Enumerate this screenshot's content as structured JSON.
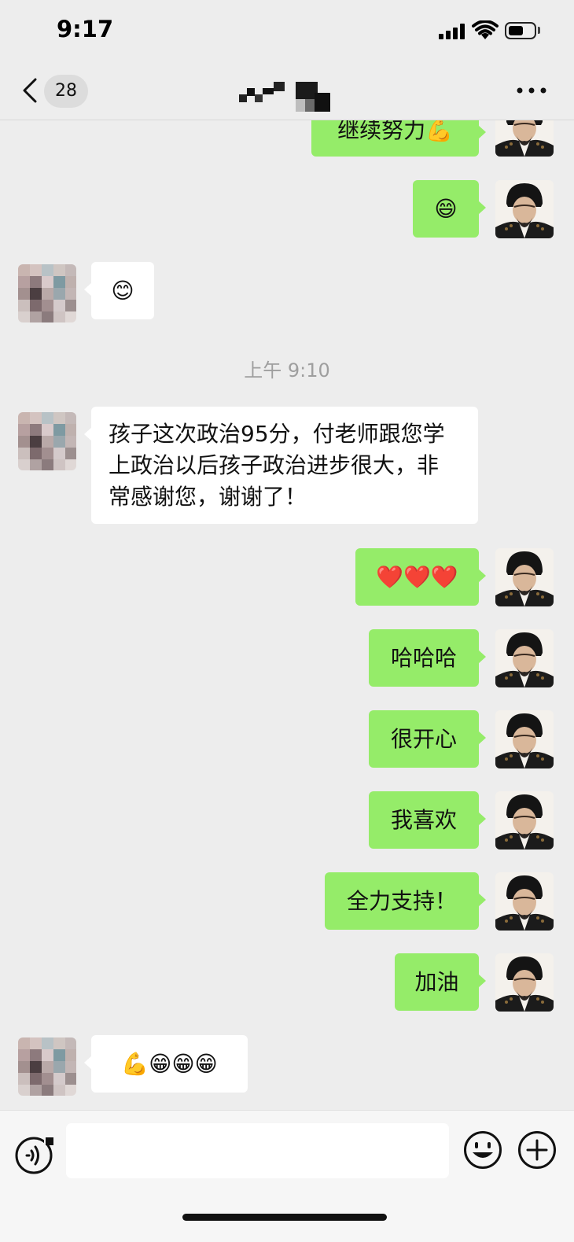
{
  "status_bar": {
    "time": "9:17"
  },
  "nav": {
    "unread_count": "28",
    "title_icon": "obscured-contact-name",
    "back_icon": "chevron-left-icon",
    "more_icon": "ellipsis-icon"
  },
  "messages": [
    {
      "side": "out",
      "text": "继续努力💪"
    },
    {
      "side": "out",
      "text": "😄"
    },
    {
      "side": "in",
      "text": "😊"
    },
    {
      "side": "timestamp",
      "text": "上午 9:10"
    },
    {
      "side": "in",
      "text": "孩子这次政治95分，付老师跟您学上政治以后孩子政治进步很大，非常感谢您，谢谢了！"
    },
    {
      "side": "out",
      "text": "❤️❤️❤️"
    },
    {
      "side": "out",
      "text": "哈哈哈"
    },
    {
      "side": "out",
      "text": "很开心"
    },
    {
      "side": "out",
      "text": "我喜欢"
    },
    {
      "side": "out",
      "text": "全力支持！"
    },
    {
      "side": "out",
      "text": "加油"
    },
    {
      "side": "in",
      "text": "💪😁😁😁"
    }
  ],
  "input": {
    "placeholder": ""
  },
  "colors": {
    "background": "#ededed",
    "outgoing_bubble": "#95ec69",
    "incoming_bubble": "#ffffff",
    "timestamp": "#9e9e9e"
  }
}
